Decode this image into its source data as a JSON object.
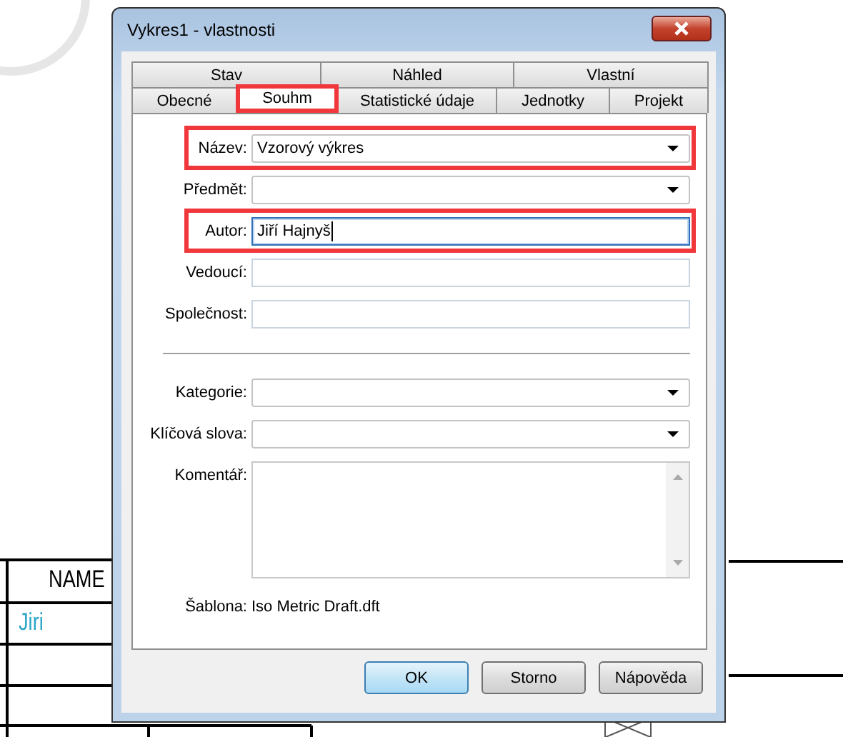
{
  "background": {
    "title_block": {
      "header": "NAME",
      "value": "Jiri"
    }
  },
  "window": {
    "title": "Vykres1 - vlastnosti"
  },
  "tab_rows": [
    [
      {
        "label": "Stav",
        "selected": false,
        "highlighted": false
      },
      {
        "label": "Náhled",
        "selected": false,
        "highlighted": false
      },
      {
        "label": "Vlastní",
        "selected": false,
        "highlighted": false
      }
    ],
    [
      {
        "label": "Obecné",
        "selected": false,
        "highlighted": false
      },
      {
        "label": "Souhm",
        "selected": true,
        "highlighted": true
      },
      {
        "label": "Statistické údaje",
        "selected": false,
        "highlighted": false
      },
      {
        "label": "Jednotky",
        "selected": false,
        "highlighted": false
      },
      {
        "label": "Projekt",
        "selected": false,
        "highlighted": false
      }
    ]
  ],
  "fields": [
    {
      "label": "Název:",
      "kind": "combo",
      "value": "Vzorový výkres",
      "highlighted": true
    },
    {
      "label": "Předmět:",
      "kind": "combo",
      "highlighted": false
    },
    {
      "label": "Autor:",
      "kind": "text",
      "value": "Jiří Hajnyš",
      "highlighted": true,
      "focused": true
    },
    {
      "label": "Vedoucí:",
      "kind": "text",
      "highlighted": false,
      "focused": false
    },
    {
      "label": "Společnost:",
      "kind": "text",
      "highlighted": false,
      "focused": false
    },
    {
      "kind": "separator"
    },
    {
      "label": "Kategorie:",
      "kind": "combo",
      "highlighted": false
    },
    {
      "label": "Klíčová slova:",
      "kind": "combo",
      "highlighted": false
    },
    {
      "label": "Komentář:",
      "kind": "memo",
      "highlighted": false
    }
  ],
  "template": {
    "label": "Šablona:",
    "value": "Iso Metric Draft.dft"
  },
  "buttons": [
    {
      "label": "OK",
      "default": true
    },
    {
      "label": "Storno",
      "default": false
    },
    {
      "label": "Nápověda",
      "default": false
    }
  ]
}
